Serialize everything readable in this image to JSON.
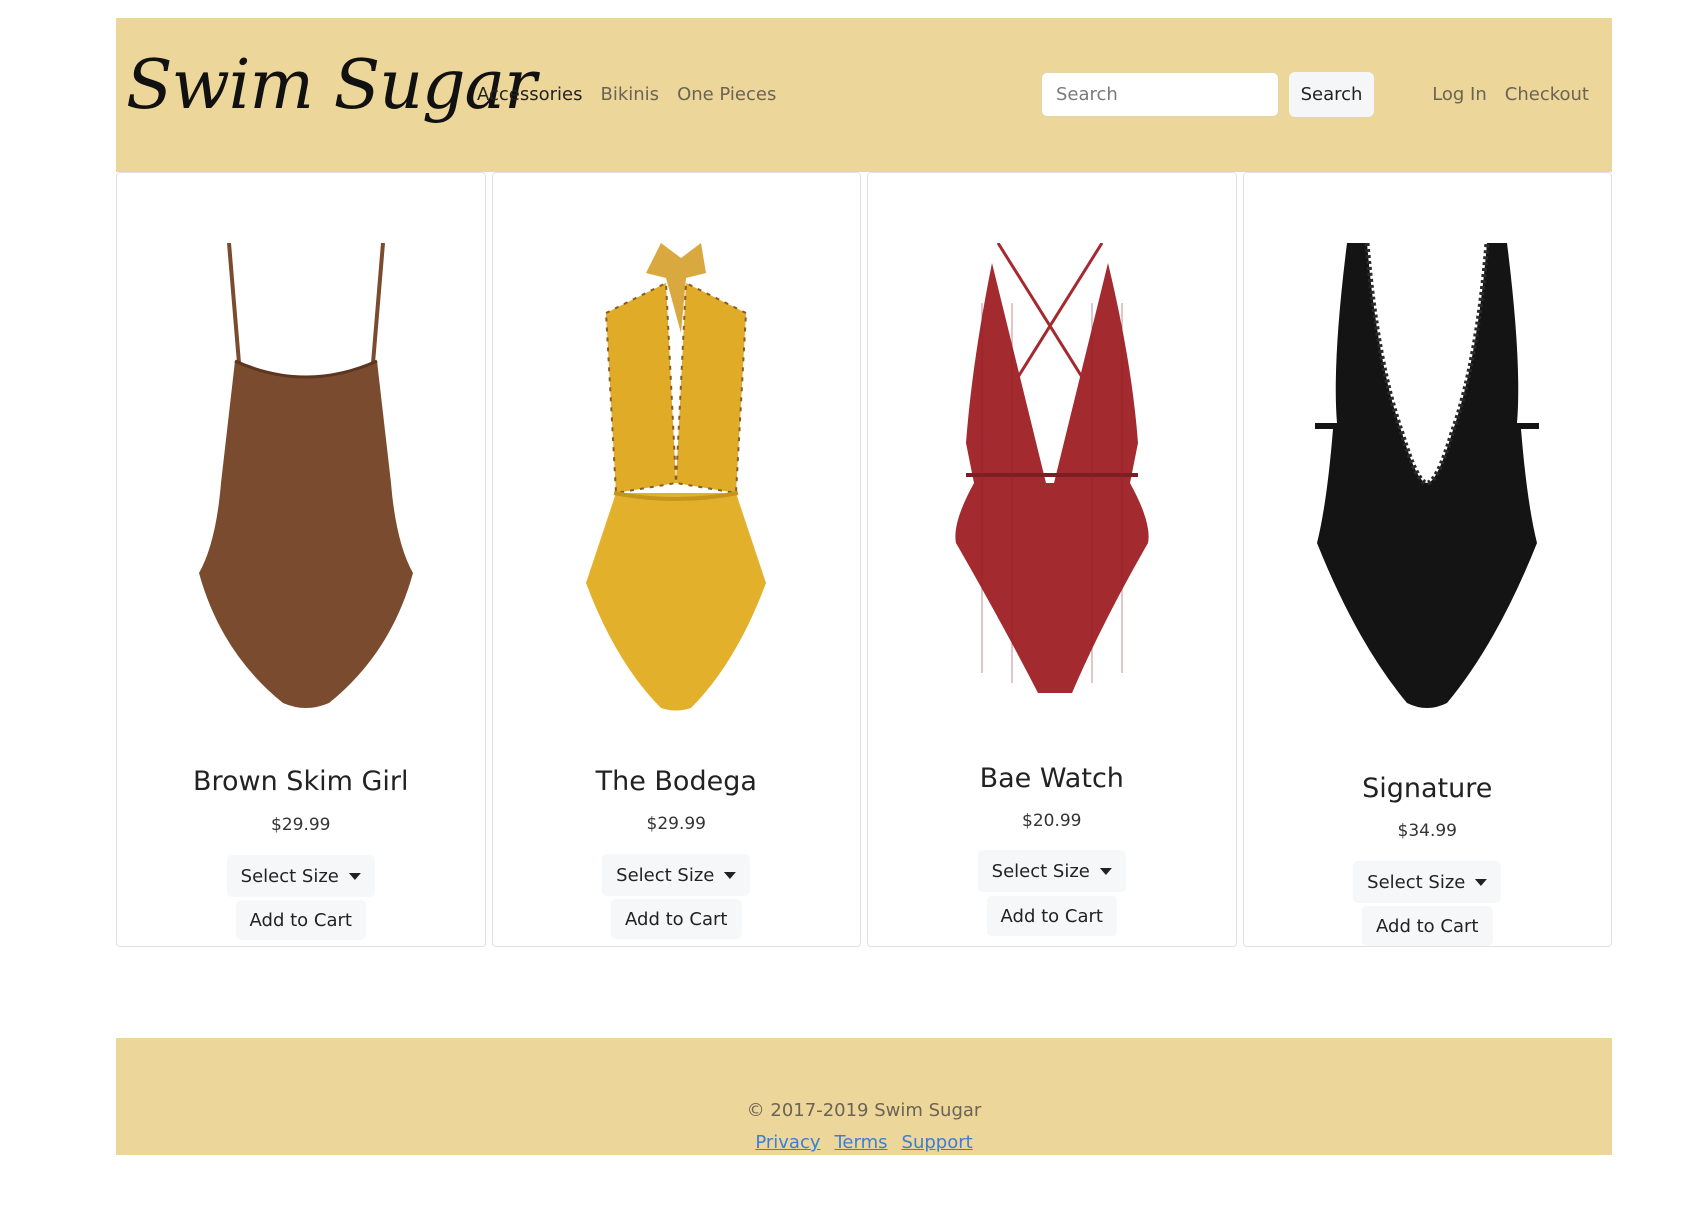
{
  "brand": "Swim Sugar",
  "nav": {
    "links": [
      "Accessories",
      "Bikinis",
      "One Pieces"
    ],
    "search_placeholder": "Search",
    "search_button": "Search",
    "auth_links": [
      "Log In",
      "Checkout"
    ]
  },
  "products": [
    {
      "name": "Brown Skim Girl",
      "price": "$29.99",
      "size_label": "Select Size",
      "cart_label": "Add to Cart",
      "color": "#7a4b2e"
    },
    {
      "name": "The Bodega",
      "price": "$29.99",
      "size_label": "Select Size",
      "cart_label": "Add to Cart",
      "color": "#e0ac28"
    },
    {
      "name": "Bae Watch",
      "price": "$20.99",
      "size_label": "Select Size",
      "cart_label": "Add to Cart",
      "color": "#a32a2e"
    },
    {
      "name": "Signature",
      "price": "$34.99",
      "size_label": "Select Size",
      "cart_label": "Add to Cart",
      "color": "#141414"
    }
  ],
  "footer": {
    "copyright": "© 2017-2019 Swim Sugar",
    "links": [
      "Privacy",
      "Terms",
      "Support"
    ]
  },
  "colors": {
    "header_bg": "#ecd69a",
    "link": "#3b7dd8"
  }
}
